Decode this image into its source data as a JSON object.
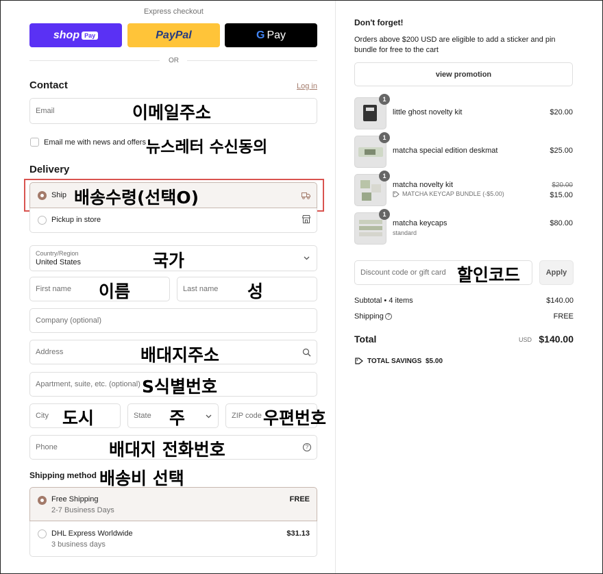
{
  "checkout": {
    "express_label": "Express checkout",
    "shop_pay_label": "shop",
    "shop_pay_badge": "Pay",
    "paypal_label": "PayPal",
    "gpay_g": "G",
    "gpay_label": "Pay",
    "or_label": "OR"
  },
  "contact": {
    "title": "Contact",
    "login_link": "Log in",
    "email_placeholder": "Email",
    "email_annotation": "이메일주소",
    "newsletter_label": "Email me with news and offers",
    "newsletter_annotation": "뉴스레터 수신동의"
  },
  "delivery": {
    "title": "Delivery",
    "ship_label": "Ship",
    "ship_annotation": "배송수령(선택O)",
    "pickup_label": "Pickup in store",
    "country_label": "Country/Region",
    "country_value": "United States",
    "country_annotation": "국가",
    "first_name_placeholder": "First name",
    "first_name_annotation": "이름",
    "last_name_placeholder": "Last name",
    "last_name_annotation": "성",
    "company_placeholder": "Company (optional)",
    "address_placeholder": "Address",
    "address_annotation": "배대지주소",
    "apartment_placeholder": "Apartment, suite, etc. (optional)",
    "apartment_annotation": "S식별번호",
    "city_placeholder": "City",
    "city_annotation": "도시",
    "state_placeholder": "State",
    "state_annotation": "주",
    "zip_placeholder": "ZIP code",
    "zip_annotation": "우편번호",
    "phone_placeholder": "Phone",
    "phone_annotation": "배대지 전화번호"
  },
  "shipping": {
    "title": "Shipping method",
    "title_annotation": "배송비 선택",
    "options": [
      {
        "name": "Free Shipping",
        "eta": "2-7 Business Days",
        "price": "FREE"
      },
      {
        "name": "DHL Express Worldwide",
        "eta": "3 business days",
        "price": "$31.13"
      }
    ]
  },
  "summary": {
    "reminder_title": "Don't forget!",
    "reminder_text_line1": "Orders above $200 USD are eligible to add a sticker and pin",
    "reminder_text_line2": "bundle for free to the cart",
    "promo_button": "view promotion",
    "items": [
      {
        "qty": "1",
        "name": "little ghost novelty kit",
        "sub": "",
        "old_price": "",
        "price": "$20.00"
      },
      {
        "qty": "1",
        "name": "matcha special edition deskmat",
        "sub": "",
        "old_price": "",
        "price": "$25.00"
      },
      {
        "qty": "1",
        "name": "matcha novelty kit",
        "sub": "MATCHA KEYCAP BUNDLE (-$5.00)",
        "old_price": "$20.00",
        "price": "$15.00"
      },
      {
        "qty": "1",
        "name": "matcha keycaps",
        "sub": "standard",
        "old_price": "",
        "price": "$80.00"
      }
    ],
    "discount_placeholder": "Discount code or gift card",
    "discount_annotation": "할인코드",
    "apply_button": "Apply",
    "subtotal_label": "Subtotal • 4 items",
    "subtotal_value": "$140.00",
    "shipping_label": "Shipping",
    "shipping_value": "FREE",
    "total_label": "Total",
    "currency": "USD",
    "total_value": "$140.00",
    "savings_label": "TOTAL SAVINGS",
    "savings_value": "$5.00"
  },
  "colors": {
    "shop_pay": "#5a31f4",
    "paypal": "#ffc439",
    "gpay": "#000000",
    "accent": "#a37a6a",
    "highlight": "#d9534f"
  }
}
